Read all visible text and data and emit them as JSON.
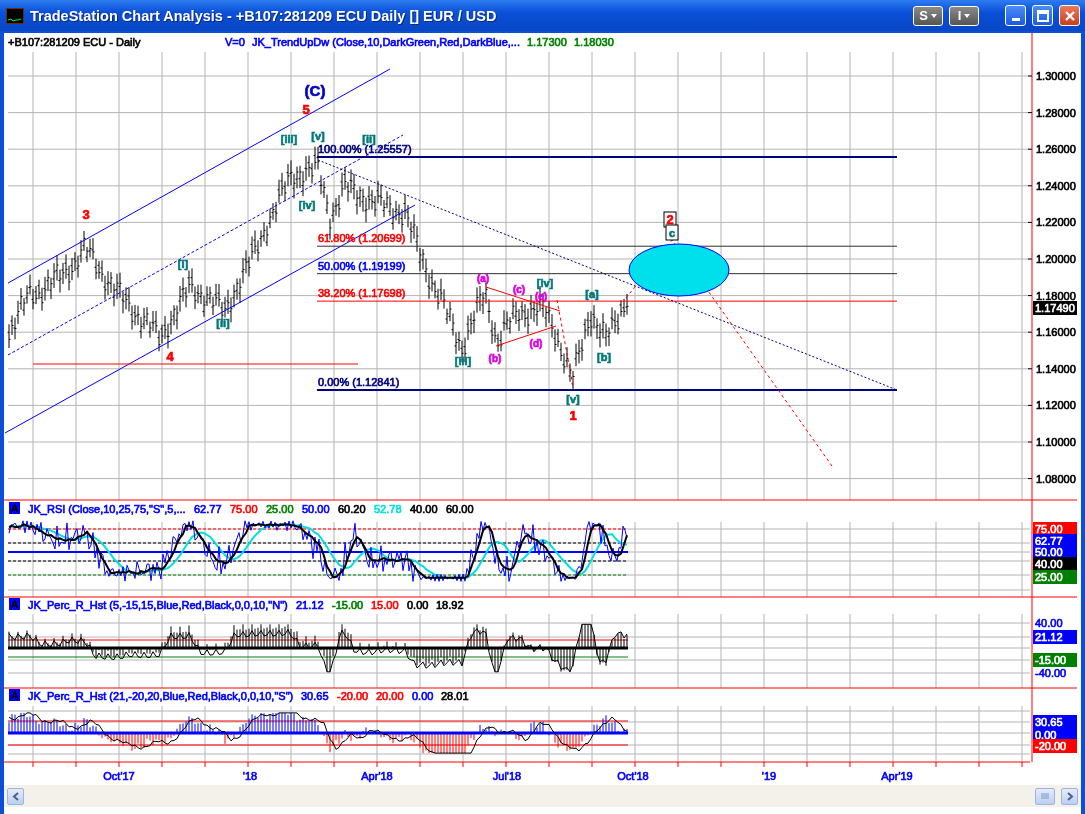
{
  "window": {
    "title": "TradeStation Chart Analysis - +B107:281209 ECU Daily [] EUR / USD",
    "buttons": [
      "S",
      "I"
    ]
  },
  "chart": {
    "symbol": "+B107:281209 ECU - Daily",
    "study": [
      {
        "text": "V=0",
        "color": "#0000ff"
      },
      {
        "text": "JK_TrendUpDw (Close,10,DarkGreen,Red,DarkBlue,...",
        "color": "#0000ff"
      },
      {
        "text": "1.17300",
        "color": "#008000"
      },
      {
        "text": "1.18030",
        "color": "#008000"
      }
    ],
    "price_axis": [
      "1.30000",
      "1.28000",
      "1.26000",
      "1.24000",
      "1.22000",
      "1.20000",
      "1.18000",
      "1.16000",
      "1.14000",
      "1.12000",
      "1.10000",
      "1.08000"
    ],
    "last_price": "1.17490",
    "fib_levels": [
      {
        "label": "100.00% (1.25557)",
        "color": "#000080"
      },
      {
        "label": "61.80% (1.20699)",
        "color": "#ff0000"
      },
      {
        "label": "50.00% (1.19199)",
        "color": "#0000ff"
      },
      {
        "label": "38.20% (1.17698)",
        "color": "#ff0000"
      },
      {
        "label": "0.00% (1.12841)",
        "color": "#000080"
      }
    ],
    "wave_labels": [
      {
        "text": "(C)",
        "color": "#0000cc",
        "kind": "large",
        "framed": false
      },
      {
        "text": "5",
        "color": "#ff0000",
        "kind": "medium",
        "framed": false
      },
      {
        "text": "[iii]",
        "color": "#007878",
        "kind": "small",
        "framed": false
      },
      {
        "text": "[v]",
        "color": "#007878",
        "kind": "small",
        "framed": false
      },
      {
        "text": "[ii]",
        "color": "#007878",
        "kind": "small",
        "framed": false
      },
      {
        "text": "3",
        "color": "#ff0000",
        "kind": "medium",
        "framed": false
      },
      {
        "text": "[i]",
        "color": "#007878",
        "kind": "small",
        "framed": false
      },
      {
        "text": "[ii]",
        "color": "#007878",
        "kind": "small",
        "framed": false
      },
      {
        "text": "4",
        "color": "#ff0000",
        "kind": "medium",
        "framed": false
      },
      {
        "text": "[iv]",
        "color": "#007878",
        "kind": "small",
        "framed": false
      },
      {
        "text": "(a)",
        "color": "#e000e0",
        "kind": "tiny",
        "framed": false
      },
      {
        "text": "(c)",
        "color": "#e000e0",
        "kind": "tiny",
        "framed": false
      },
      {
        "text": "(e)",
        "color": "#e000e0",
        "kind": "tiny",
        "framed": false
      },
      {
        "text": "[iv]",
        "color": "#007878",
        "kind": "small",
        "framed": false
      },
      {
        "text": "(b)",
        "color": "#e000e0",
        "kind": "tiny",
        "framed": false
      },
      {
        "text": "(d)",
        "color": "#e000e0",
        "kind": "tiny",
        "framed": false
      },
      {
        "text": "[iii]",
        "color": "#007878",
        "kind": "small",
        "framed": false
      },
      {
        "text": "[v]",
        "color": "#007878",
        "kind": "small",
        "framed": false
      },
      {
        "text": "1",
        "color": "#ff0000",
        "kind": "medium",
        "framed": false
      },
      {
        "text": "[a]",
        "color": "#007878",
        "kind": "small",
        "framed": false
      },
      {
        "text": "[b]",
        "color": "#007878",
        "kind": "small",
        "framed": false
      },
      {
        "text": "2",
        "color": "#ff0000",
        "kind": "medium",
        "framed": true
      },
      {
        "text": "c",
        "color": "#007878",
        "kind": "small",
        "framed": true
      }
    ],
    "panels": [
      {
        "kind": "rsi",
        "badge": "A",
        "header": [
          {
            "text": "JK_RSI (Close,10,25,75,\"S\",5,...",
            "color": "#0000ff"
          },
          {
            "text": "62.77",
            "color": "#0000ff"
          },
          {
            "text": "75.00",
            "color": "#ff0000"
          },
          {
            "text": "25.00",
            "color": "#008000"
          },
          {
            "text": "50.00",
            "color": "#0000ff"
          },
          {
            "text": "60.20",
            "color": "#000000"
          },
          {
            "text": "52.78",
            "color": "#00e0e0"
          },
          {
            "text": "40.00",
            "color": "#000000"
          },
          {
            "text": "60.00",
            "color": "#000000"
          }
        ],
        "axis": [
          {
            "text": "75.00",
            "color": "#ff0000",
            "boxed": true
          },
          {
            "text": "62.77",
            "color": "#0000ff",
            "boxed": true
          },
          {
            "text": "50.00",
            "color": "#0000ff",
            "boxed": true
          },
          {
            "text": "40.00",
            "color": "#000000",
            "boxed": true
          },
          {
            "text": "25.00",
            "color": "#008000",
            "boxed": true
          }
        ]
      },
      {
        "kind": "fast",
        "badge": "A",
        "header": [
          {
            "text": "JK_Perc_R_Hst (5,-15,15,Blue,Red,Black,0,0,10,\"N\")",
            "color": "#0000ff"
          },
          {
            "text": "21.12",
            "color": "#0000ff"
          },
          {
            "text": "-15.00",
            "color": "#008000"
          },
          {
            "text": "15.00",
            "color": "#ff0000"
          },
          {
            "text": "0.00",
            "color": "#000000"
          },
          {
            "text": "18.92",
            "color": "#000000"
          }
        ],
        "axis": [
          {
            "text": "40.00",
            "color": "#0000ff",
            "boxed": false
          },
          {
            "text": "21.12",
            "color": "#0000ff",
            "boxed": true
          },
          {
            "text": "-15.00",
            "color": "#008000",
            "boxed": true
          },
          {
            "text": "-40.00",
            "color": "#0000ff",
            "boxed": false
          }
        ]
      },
      {
        "kind": "slow",
        "badge": "A",
        "header": [
          {
            "text": "JK_Perc_R_Hst (21,-20,20,Blue,Red,Black,0,0,10,\"S\")",
            "color": "#0000ff"
          },
          {
            "text": "30.65",
            "color": "#0000ff"
          },
          {
            "text": "-20.00",
            "color": "#ff0000"
          },
          {
            "text": "20.00",
            "color": "#ff0000"
          },
          {
            "text": "0.00",
            "color": "#0000ff"
          },
          {
            "text": "28.01",
            "color": "#000000"
          }
        ],
        "axis": [
          {
            "text": "30.65",
            "color": "#0000ff",
            "boxed": true
          },
          {
            "text": "0.00",
            "color": "#0000ff",
            "boxed": true
          },
          {
            "text": "-20.00",
            "color": "#ff0000",
            "boxed": true
          }
        ]
      }
    ],
    "date_axis": [
      "Oct'17",
      "'18",
      "Apr'18",
      "Jul'18",
      "Oct'18",
      "'19",
      "Apr'19"
    ]
  }
}
